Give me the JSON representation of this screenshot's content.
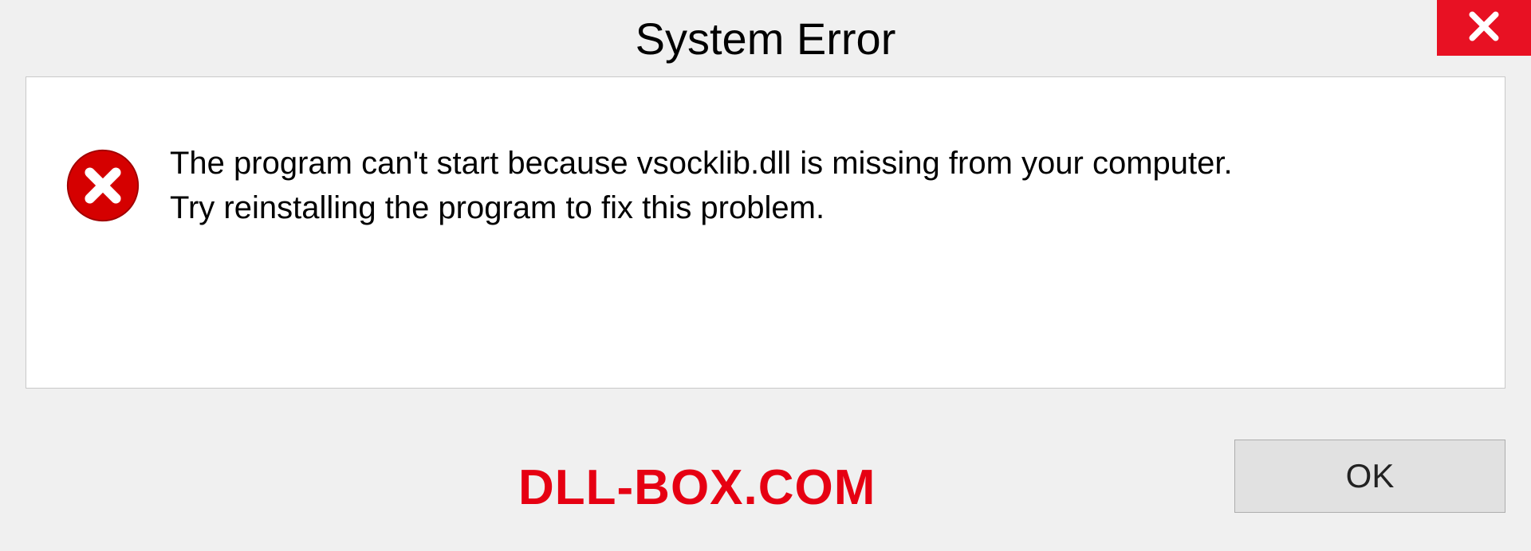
{
  "dialog": {
    "title": "System Error",
    "message": "The program can't start because vsocklib.dll is missing from your computer.\nTry reinstalling the program to fix this problem.",
    "ok_label": "OK"
  },
  "watermark": "DLL-BOX.COM",
  "icons": {
    "close": "close-icon",
    "error": "error-circle-x-icon"
  },
  "colors": {
    "close_bg": "#e81123",
    "error_icon": "#d50000",
    "watermark": "#e60012"
  }
}
